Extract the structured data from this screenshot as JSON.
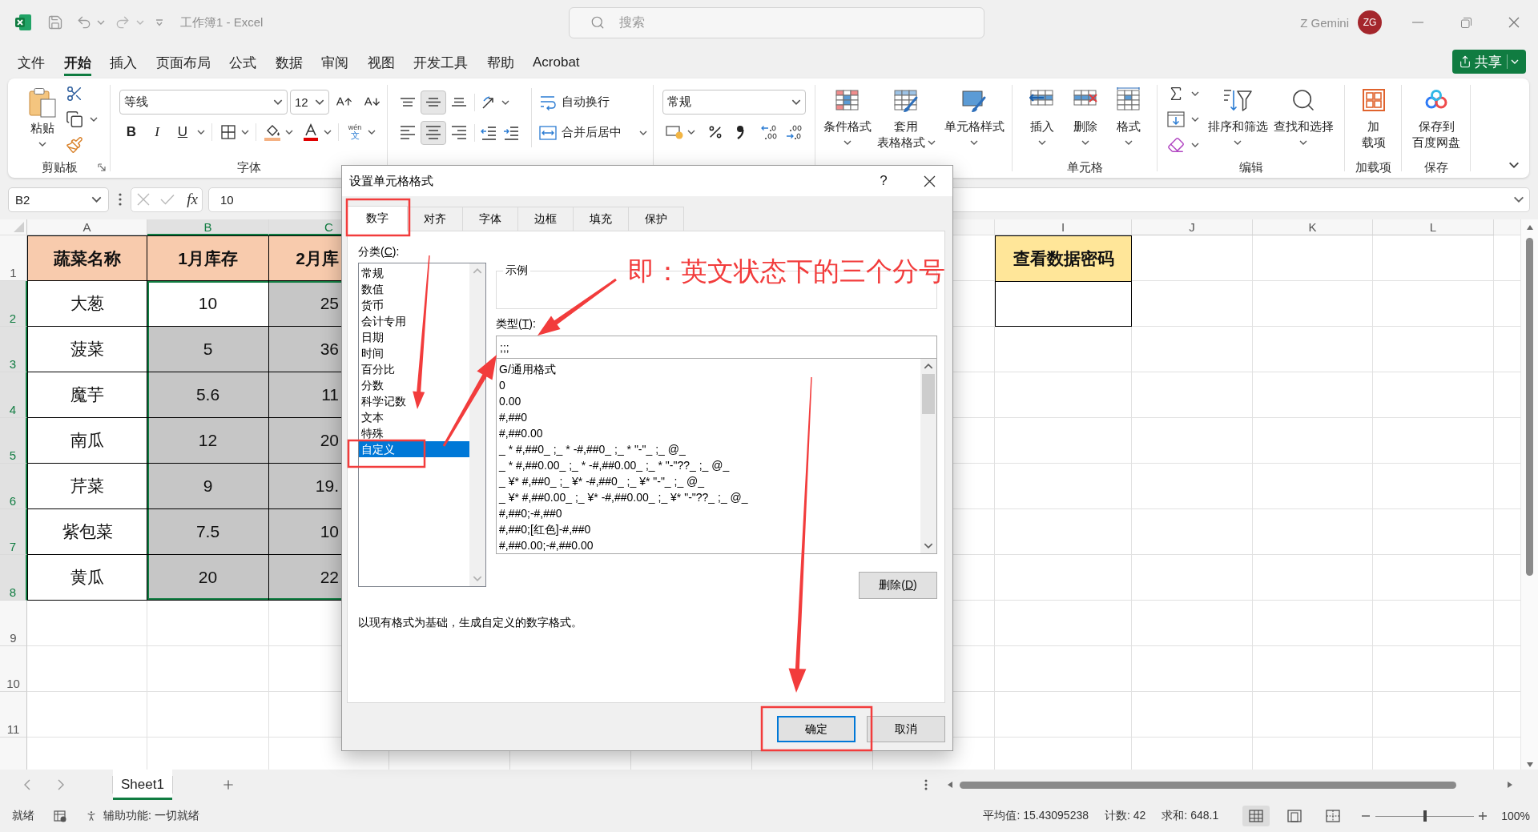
{
  "window": {
    "title": "工作簿1 - Excel",
    "search": {
      "placeholder": "搜索"
    },
    "user_name": "Z Gemini",
    "avatar": "ZG"
  },
  "menu_tabs": [
    {
      "label": "文件",
      "selected": false
    },
    {
      "label": "开始",
      "selected": true
    },
    {
      "label": "插入",
      "selected": false
    },
    {
      "label": "页面布局",
      "selected": false
    },
    {
      "label": "公式",
      "selected": false
    },
    {
      "label": "数据",
      "selected": false
    },
    {
      "label": "审阅",
      "selected": false
    },
    {
      "label": "视图",
      "selected": false
    },
    {
      "label": "开发工具",
      "selected": false
    },
    {
      "label": "帮助",
      "selected": false
    },
    {
      "label": "Acrobat",
      "selected": false
    }
  ],
  "share_button": "共享",
  "ribbon": {
    "clipboard": {
      "paste": "粘贴",
      "label": "剪贴板"
    },
    "font": {
      "name": "等线",
      "size": "12",
      "styles": [
        {
          "kind": "bold",
          "label": "B"
        },
        {
          "kind": "italic",
          "label": "I"
        },
        {
          "kind": "underline",
          "label": "U"
        }
      ],
      "phonetic": {
        "pinyin": "wén",
        "character": "文"
      },
      "label": "字体"
    },
    "alignment": {
      "vertical": [
        {
          "kind": "top",
          "selected": false
        },
        {
          "kind": "middle",
          "selected": true
        },
        {
          "kind": "bottom",
          "selected": false
        }
      ],
      "horizontal": [
        {
          "kind": "left",
          "selected": false
        },
        {
          "kind": "center",
          "selected": true
        },
        {
          "kind": "right",
          "selected": false
        }
      ],
      "wrap_text": "自动换行",
      "merge_center": "合并后居中"
    },
    "number": {
      "format": "常规"
    },
    "styles": {
      "buttons": [
        {
          "kind": "conditional",
          "lines": [
            "条件格式"
          ],
          "dropdown": true
        },
        {
          "kind": "table",
          "lines": [
            "套用",
            "表格格式"
          ],
          "dropdown": true
        },
        {
          "kind": "cell_styles",
          "lines": [
            "单元格样式"
          ],
          "dropdown": true
        }
      ]
    },
    "cells": {
      "buttons": [
        {
          "kind": "insert",
          "lines": [
            "插入"
          ],
          "dropdown": true
        },
        {
          "kind": "delete",
          "lines": [
            "删除"
          ],
          "dropdown": true
        },
        {
          "kind": "format",
          "lines": [
            "格式"
          ],
          "dropdown": true
        }
      ],
      "label": "单元格"
    },
    "editing": {
      "buttons": [
        {
          "kind": "sort",
          "lines": [
            "排序和筛选"
          ],
          "dropdown": true
        },
        {
          "kind": "find",
          "lines": [
            "查找和选择"
          ],
          "dropdown": true
        }
      ],
      "label": "编辑"
    },
    "addins": {
      "buttons": [
        {
          "kind": "addins",
          "lines": [
            "加",
            "载项"
          ],
          "dropdown": false
        }
      ],
      "label": "加载项"
    },
    "save": {
      "buttons": [
        {
          "kind": "cloud",
          "lines": [
            "保存到",
            "百度网盘"
          ],
          "dropdown": false
        }
      ],
      "label": "保存"
    }
  },
  "formula_bar": {
    "name_box": "B2",
    "function_button": "fx",
    "value": "10"
  },
  "sheet": {
    "columns": [
      {
        "label": "A",
        "selected": false
      },
      {
        "label": "B",
        "selected": true
      },
      {
        "label": "C",
        "selected": true
      },
      {
        "label": "I",
        "selected": false
      },
      {
        "label": "J",
        "selected": false
      },
      {
        "label": "K",
        "selected": false
      },
      {
        "label": "L",
        "selected": false
      }
    ],
    "rows": [
      {
        "label": "1",
        "selected": false
      },
      {
        "label": "2",
        "selected": true
      },
      {
        "label": "3",
        "selected": true
      },
      {
        "label": "4",
        "selected": true
      },
      {
        "label": "5",
        "selected": true
      },
      {
        "label": "6",
        "selected": true
      },
      {
        "label": "7",
        "selected": true
      },
      {
        "label": "8",
        "selected": true
      },
      {
        "label": "9",
        "selected": false
      },
      {
        "label": "10",
        "selected": false
      },
      {
        "label": "11",
        "selected": false
      }
    ],
    "table": {
      "header": [
        "蔬菜名称",
        "1月库存",
        "2月库"
      ],
      "rows": [
        {
          "name": "大葱",
          "values": [
            {
              "text": "10",
              "shaded": false
            },
            {
              "text": "25",
              "shaded": true
            }
          ]
        },
        {
          "name": "菠菜",
          "values": [
            {
              "text": "5",
              "shaded": true
            },
            {
              "text": "36",
              "shaded": true
            }
          ]
        },
        {
          "name": "魔芋",
          "values": [
            {
              "text": "5.6",
              "shaded": true
            },
            {
              "text": "11",
              "shaded": true
            }
          ]
        },
        {
          "name": "南瓜",
          "values": [
            {
              "text": "12",
              "shaded": true
            },
            {
              "text": "20",
              "shaded": true
            }
          ]
        },
        {
          "name": "芹菜",
          "values": [
            {
              "text": "9",
              "shaded": true
            },
            {
              "text": "19.",
              "shaded": true
            }
          ]
        },
        {
          "name": "紫包菜",
          "values": [
            {
              "text": "7.5",
              "shaded": true
            },
            {
              "text": "10",
              "shaded": true
            }
          ]
        },
        {
          "name": "黄瓜",
          "values": [
            {
              "text": "20",
              "shaded": true
            },
            {
              "text": "22",
              "shaded": true
            }
          ]
        }
      ]
    },
    "password_label": "查看数据密码"
  },
  "sheet_tabs": [
    {
      "label": "Sheet1",
      "selected": true
    }
  ],
  "status_bar": {
    "ready": "就绪",
    "accessibility": "辅助功能: 一切就绪",
    "average": "平均值: 15.43095238",
    "count": "计数: 42",
    "sum": "求和: 648.1",
    "views": [
      {
        "kind": "normal",
        "selected": true
      },
      {
        "kind": "page_layout",
        "selected": false
      },
      {
        "kind": "page_break",
        "selected": false
      }
    ],
    "zoom": {
      "level": 0.5,
      "reading": "100%"
    }
  },
  "dialog": {
    "title": "设置单元格格式",
    "help": "?",
    "tabs": [
      {
        "label": "数字",
        "selected": true
      },
      {
        "label": "对齐",
        "selected": false
      },
      {
        "label": "字体",
        "selected": false
      },
      {
        "label": "边框",
        "selected": false
      },
      {
        "label": "填充",
        "selected": false
      },
      {
        "label": "保护",
        "selected": false
      }
    ],
    "category_label": {
      "text": "分类(",
      "key": "C",
      "end": "):"
    },
    "categories": [
      {
        "label": "常规",
        "selected": false
      },
      {
        "label": "数值",
        "selected": false
      },
      {
        "label": "货币",
        "selected": false
      },
      {
        "label": "会计专用",
        "selected": false
      },
      {
        "label": "日期",
        "selected": false
      },
      {
        "label": "时间",
        "selected": false
      },
      {
        "label": "百分比",
        "selected": false
      },
      {
        "label": "分数",
        "selected": false
      },
      {
        "label": "科学记数",
        "selected": false
      },
      {
        "label": "文本",
        "selected": false
      },
      {
        "label": "特殊",
        "selected": false
      },
      {
        "label": "自定义",
        "selected": true
      }
    ],
    "sample_label": "示例",
    "type_label": {
      "text": "类型(",
      "key": "T",
      "end": "):"
    },
    "type_value": ";;;",
    "formats": [
      "G/通用格式",
      "0",
      "0.00",
      "#,##0",
      "#,##0.00",
      "_ * #,##0_ ;_ * -#,##0_ ;_ * \"-\"_ ;_ @_",
      "_ * #,##0.00_ ;_ * -#,##0.00_ ;_ * \"-\"??_ ;_ @_",
      "_ ¥* #,##0_ ;_ ¥* -#,##0_ ;_ ¥* \"-\"_ ;_ @_",
      "_ ¥* #,##0.00_ ;_ ¥* -#,##0.00_ ;_ ¥* \"-\"??_ ;_ @_",
      "#,##0;-#,##0",
      "#,##0;[红色]-#,##0",
      "#,##0.00;-#,##0.00"
    ],
    "delete_button": {
      "text": "删除(",
      "key": "D",
      "end": ")"
    },
    "description": "以现有格式为基础，生成自定义的数字格式。",
    "buttons": [
      {
        "label": "确定",
        "default": true
      },
      {
        "label": "取消",
        "default": false
      }
    ]
  },
  "annotation": {
    "text": "即：英文状态下的三个分号"
  }
}
